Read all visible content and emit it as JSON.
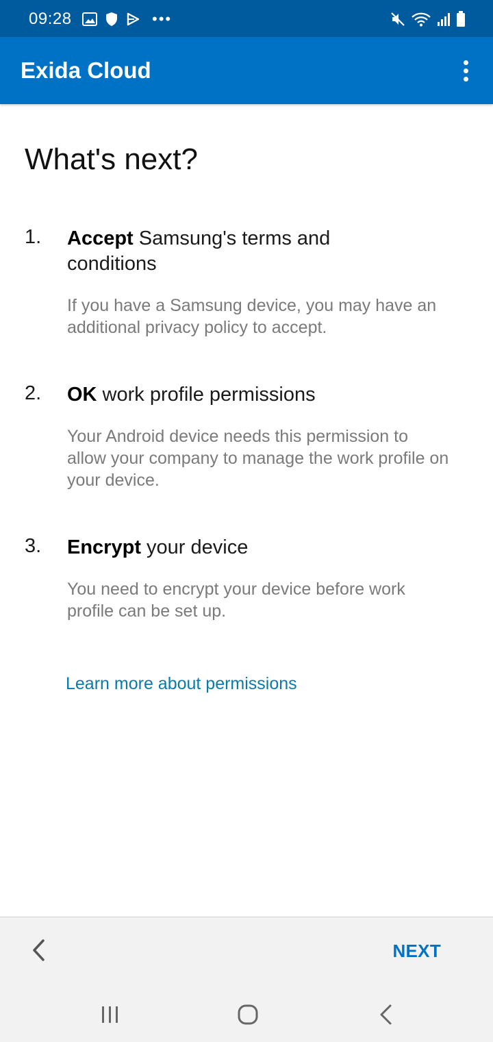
{
  "status_bar": {
    "time": "09:28",
    "left_icons": [
      "gallery-icon",
      "shield-icon",
      "play-store-icon",
      "more-notifications-icon"
    ],
    "right_icons": [
      "mute-icon",
      "wifi-icon",
      "signal-icon",
      "battery-icon"
    ],
    "overflow_dots": "•••"
  },
  "app_bar": {
    "title": "Exida Cloud",
    "menu_icon": "overflow-menu-icon"
  },
  "main": {
    "title": "What's next?",
    "steps": [
      {
        "number": "1.",
        "bold": "Accept",
        "rest": " Samsung's terms and conditions",
        "description": "If you have a Samsung device, you may have an additional privacy policy to accept."
      },
      {
        "number": "2.",
        "bold": "OK",
        "rest": " work profile permissions",
        "description": "Your Android device needs this permission to allow your company to manage the work profile on your device."
      },
      {
        "number": "3.",
        "bold": "Encrypt",
        "rest": " your device",
        "description": "You need to encrypt your device before work profile can be set up."
      }
    ],
    "learn_more": "Learn more about permissions"
  },
  "footer": {
    "back_icon": "chevron-left-icon",
    "next_label": "NEXT"
  },
  "system_nav": {
    "recents_icon": "recents-icon",
    "home_icon": "home-icon",
    "back_icon": "back-icon"
  },
  "colors": {
    "status_bar": "#005a9e",
    "app_bar": "#0072c6",
    "link": "#0b7aa8",
    "next": "#0072c6"
  }
}
